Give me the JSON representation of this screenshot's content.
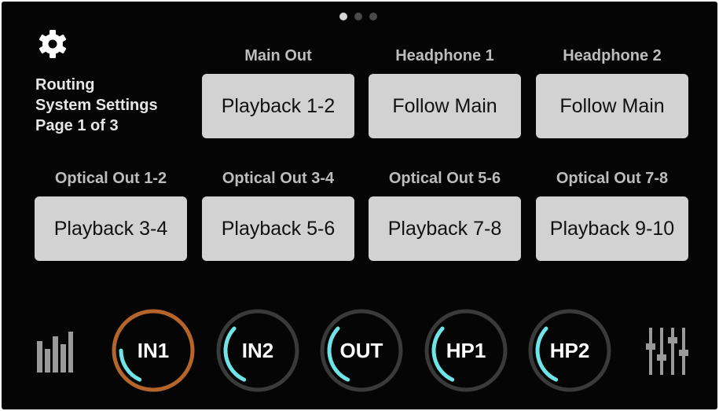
{
  "page_indicator": {
    "count": 3,
    "active": 0
  },
  "header": {
    "section": "Routing",
    "subtitle": "System Settings",
    "page_text": "Page 1 of 3"
  },
  "routes": [
    {
      "label": "Main Out",
      "value": "Playback 1-2"
    },
    {
      "label": "Headphone 1",
      "value": "Follow Main"
    },
    {
      "label": "Headphone 2",
      "value": "Follow Main"
    },
    {
      "label": "Optical Out 1-2",
      "value": "Playback 3-4"
    },
    {
      "label": "Optical Out 3-4",
      "value": "Playback 5-6"
    },
    {
      "label": "Optical Out  5-6",
      "value": "Playback 7-8"
    },
    {
      "label": "Optical Out 7-8",
      "value": "Playback 9-10"
    }
  ],
  "knobs": [
    {
      "label": "IN1",
      "selected": true,
      "level": 0.18
    },
    {
      "label": "IN2",
      "selected": false,
      "level": 0.3
    },
    {
      "label": "OUT",
      "selected": false,
      "level": 0.3
    },
    {
      "label": "HP1",
      "selected": false,
      "level": 0.3
    },
    {
      "label": "HP2",
      "selected": false,
      "level": 0.3
    }
  ],
  "icons": {
    "settings": "gear-icon",
    "meters": "meters-icon",
    "mixer": "mixer-icon"
  },
  "colors": {
    "screen_bg": "#050505",
    "button_bg": "#d2d2d2",
    "label_text": "#bdbdbd",
    "arc_active": "#6fe3e6",
    "ring_selected": "#b5652a",
    "ring_default": "#3a3a3a"
  }
}
